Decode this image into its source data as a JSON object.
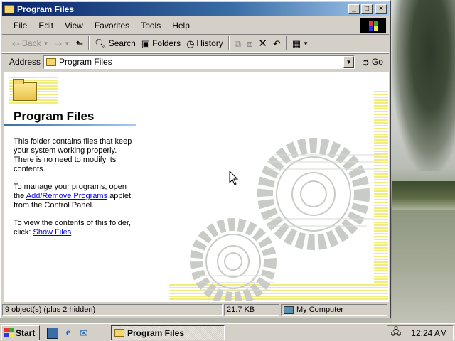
{
  "window": {
    "title": "Program Files"
  },
  "menu": {
    "items": [
      "File",
      "Edit",
      "View",
      "Favorites",
      "Tools",
      "Help"
    ]
  },
  "toolbar": {
    "back_label": "Back",
    "search_label": "Search",
    "folders_label": "Folders",
    "history_label": "History"
  },
  "address": {
    "label": "Address",
    "value": "Program Files",
    "go_label": "Go"
  },
  "content": {
    "heading": "Program Files",
    "para1": "This folder contains files that keep your system working properly. There is no need to modify its contents.",
    "para2_pre": "To manage your programs, open the ",
    "para2_link": "Add/Remove Programs",
    "para2_post": " applet from the Control Panel.",
    "para3_pre": "To view the contents of this folder, click: ",
    "para3_link": "Show Files"
  },
  "status": {
    "objects": "9 object(s) (plus 2 hidden)",
    "size": "21.7 KB",
    "zone": "My Computer"
  },
  "taskbar": {
    "start_label": "Start",
    "task_label": "Program Files",
    "clock": "12:24 AM"
  },
  "colors": {
    "titlebar_start": "#0a246a",
    "titlebar_end": "#a6caf0",
    "link": "#0000ee",
    "gear": "#c9cbc6",
    "accent_yellow": "#f2ec78"
  }
}
